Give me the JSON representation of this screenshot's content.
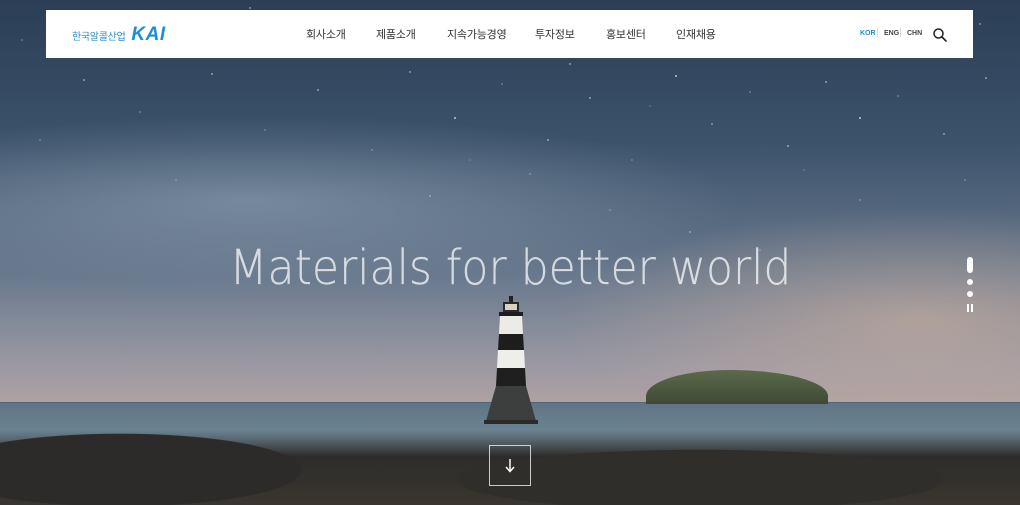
{
  "header": {
    "logo": {
      "company_name_kr": "한국알콜산업",
      "brand_mark": "KAI"
    },
    "nav": [
      {
        "label": "회사소개"
      },
      {
        "label": "제품소개"
      },
      {
        "label": "지속가능경영"
      },
      {
        "label": "투자정보"
      },
      {
        "label": "홍보센터"
      },
      {
        "label": "인재채용"
      }
    ],
    "languages": [
      {
        "label": "KOR",
        "active": true
      },
      {
        "label": "ENG",
        "active": false
      },
      {
        "label": "CHN",
        "active": false
      }
    ],
    "search_icon": "search-icon"
  },
  "hero": {
    "headline": "Materials for better world",
    "slides_count": 3,
    "active_slide": 1,
    "scroll_down_icon": "arrow-down-icon"
  },
  "colors": {
    "brand_blue": "#1d8fd0",
    "header_bg": "#ffffff",
    "nav_text": "#333333"
  }
}
